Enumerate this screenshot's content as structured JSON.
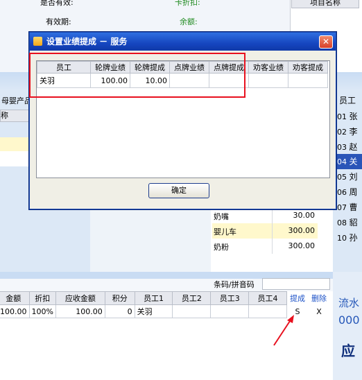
{
  "top_form": {
    "valid_label": "是否有效:",
    "card_discount_label": "卡折扣:",
    "expiry_label": "有效期:",
    "balance_label": "余额:",
    "item_name_header": "项目名称"
  },
  "left_panel": {
    "title": "母婴产品",
    "col_label": "称"
  },
  "products": [
    {
      "name": "奶嘴",
      "price": "30.00"
    },
    {
      "name": "婴儿车",
      "price": "300.00"
    },
    {
      "name": "奶粉",
      "price": "300.00"
    }
  ],
  "employee_panel": {
    "header": "员工",
    "rows": [
      {
        "code": "01",
        "name": "张"
      },
      {
        "code": "02",
        "name": "李"
      },
      {
        "code": "03",
        "name": "赵"
      },
      {
        "code": "04",
        "name": "关"
      },
      {
        "code": "05",
        "name": "刘"
      },
      {
        "code": "06",
        "name": "周"
      },
      {
        "code": "07",
        "name": "曹"
      },
      {
        "code": "08",
        "name": "貂"
      },
      {
        "code": "10",
        "name": "孙"
      }
    ]
  },
  "barcode": {
    "label": "条码/拼音码",
    "value": ""
  },
  "bottom_table": {
    "headers": [
      "金额",
      "折扣",
      "应收金额",
      "积分",
      "员工1",
      "员工2",
      "员工3",
      "员工4",
      "提成",
      "删除"
    ],
    "row": {
      "amount": "100.00",
      "discount": "100%",
      "receivable": "100.00",
      "points": "0",
      "emp1": "关羽",
      "emp2": "",
      "emp3": "",
      "emp4": "",
      "commission": "S",
      "delete": "X"
    }
  },
  "right_summary": {
    "serial_label": "流水",
    "serial_value": "000",
    "due_label": "应"
  },
  "dialog": {
    "title": "设置业绩提成 － 服务",
    "close_symbol": "✕",
    "columns": [
      "员工",
      "轮牌业绩",
      "轮牌提成",
      "点牌业绩",
      "点牌提成",
      "劝客业绩",
      "劝客提成"
    ],
    "rows": [
      {
        "employee": "关羽",
        "rot_perf": "100.00",
        "rot_comm": "10.00",
        "pick_perf": "",
        "pick_comm": "",
        "adv_perf": "",
        "adv_comm": ""
      }
    ],
    "ok_label": "确定"
  }
}
